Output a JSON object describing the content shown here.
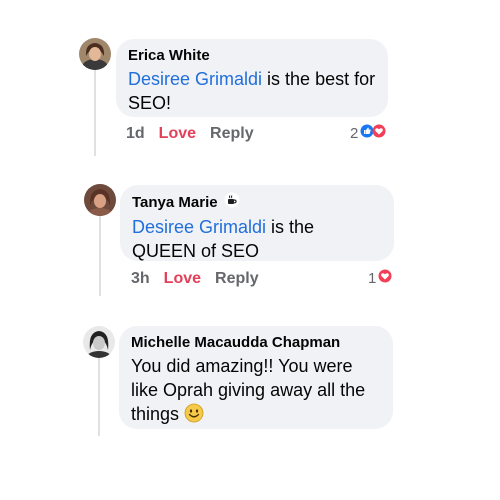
{
  "comments": [
    {
      "author": "Erica White",
      "mention": "Desiree Grimaldi",
      "text_rest": " is the best for SEO!",
      "time": "1d",
      "like_label": "Love",
      "reply_label": "Reply",
      "reaction_count": "2",
      "reactions": [
        "like-icon",
        "love-icon"
      ]
    },
    {
      "author": "Tanya Marie",
      "author_badge": "coffee-cup-icon",
      "mention": "Desiree Grimaldi",
      "text_rest": " is the QUEEN of SEO",
      "time": "3h",
      "like_label": "Love",
      "reply_label": "Reply",
      "reaction_count": "1",
      "reactions": [
        "love-icon"
      ]
    },
    {
      "author": "Michelle Macaudda Chapman",
      "text": "You did amazing!! You were like Oprah giving away all the things",
      "emoji": "smiley-emoji-icon"
    }
  ],
  "colors": {
    "bubble": "#f0f2f5",
    "mention": "#216fdb",
    "love": "#e4405a",
    "like_reaction": "#1877f2",
    "meta": "#65676b"
  }
}
